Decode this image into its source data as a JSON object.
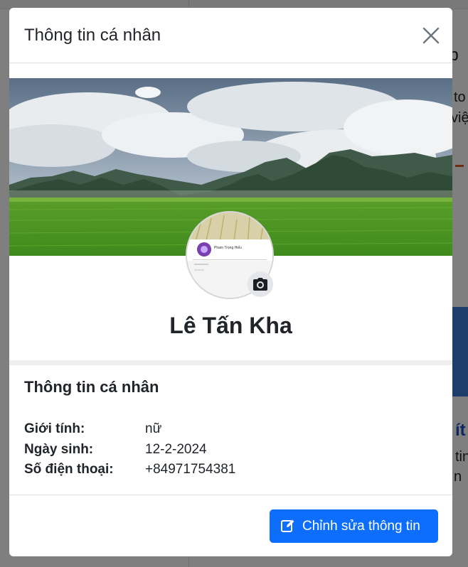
{
  "background": {
    "snippets": [
      "op",
      "to",
      "việ",
      "ít",
      "tin",
      "n"
    ]
  },
  "modal": {
    "title": "Thông tin cá nhân",
    "close_icon": "close-icon",
    "camera_icon": "camera-icon",
    "edit_icon": "edit-icon"
  },
  "profile": {
    "name": "Lê Tấn Kha",
    "avatar_snippet": "Pham Trọng Hiếu"
  },
  "info": {
    "section_title": "Thông tin cá nhân",
    "rows": [
      {
        "label": "Giới tính:",
        "value": "nữ"
      },
      {
        "label": "Ngày sinh:",
        "value": "12-2-2024"
      },
      {
        "label": "Số điện thoại:",
        "value": "+84971754381"
      }
    ]
  },
  "footer": {
    "edit_label": "Chỉnh sửa thông tin"
  },
  "colors": {
    "primary": "#0d6efd",
    "text": "#212529",
    "backdrop": "rgba(0,0,0,0.5)"
  }
}
